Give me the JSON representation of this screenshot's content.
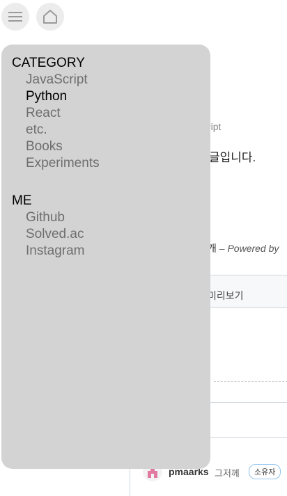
{
  "drawer": {
    "sections": [
      {
        "title": "CATEGORY",
        "items": [
          "JavaScript",
          "Python",
          "React",
          "etc.",
          "Books",
          "Experiments"
        ],
        "active_index": 1
      },
      {
        "title": "ME",
        "items": [
          "Github",
          "Solved.ac",
          "Instagram"
        ]
      }
    ]
  },
  "background": {
    "tag_fragment": "ript",
    "desc_fragment": "글입니다.",
    "count_fragment": "개",
    "powered_fragment": "– Powered by",
    "tab_preview": "미리보기",
    "comment": {
      "user": "pmaarks",
      "time": "그저께",
      "badge": "소유자"
    }
  },
  "colors": {
    "drawer_bg": "#d3d3d3",
    "active_text": "#000000",
    "inactive_text": "#6e6e6e"
  },
  "icons": {
    "menu": "hamburger-icon",
    "home": "home-icon"
  }
}
